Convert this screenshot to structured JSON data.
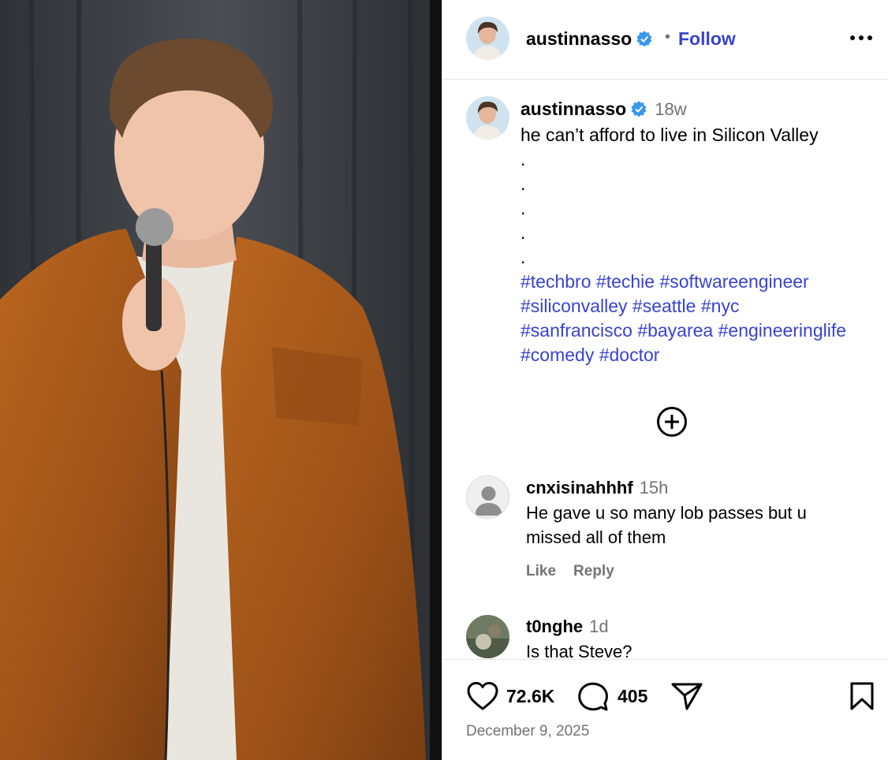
{
  "post": {
    "author": "austinnasso",
    "follow_label": "Follow",
    "separator": "•",
    "caption_age": "18w",
    "caption_line": "he can’t afford to live in Silicon Valley",
    "caption_dots": [
      ".",
      ".",
      ".",
      ".",
      "."
    ],
    "hashtags": [
      [
        "#techbro",
        "#techie",
        "#softwareengineer"
      ],
      [
        "#siliconvalley",
        "#seattle",
        "#nyc"
      ],
      [
        "#sanfrancisco",
        "#bayarea",
        "#engineeringlife"
      ],
      [
        "#comedy",
        "#doctor"
      ]
    ]
  },
  "comments": [
    {
      "user": "cnxisinahhhf",
      "age": "15h",
      "text": "He gave u so many lob passes but u missed all of them",
      "like_label": "Like",
      "reply_label": "Reply"
    },
    {
      "user": "t0nghe",
      "age": "1d",
      "text": "Is that Steve?"
    }
  ],
  "footer": {
    "likes": "72.6K",
    "comments": "405",
    "date": "December 9, 2025"
  },
  "icons": {
    "more": "more-options-icon",
    "add": "add-comment-icon",
    "like": "heart-icon",
    "comment": "comment-bubble-icon",
    "share": "send-icon",
    "save": "bookmark-icon",
    "verified": "verified-badge-icon"
  },
  "colors": {
    "link": "#3843d0",
    "verified": "#3897f0",
    "muted": "#737373",
    "jacket": "#a4581c"
  }
}
